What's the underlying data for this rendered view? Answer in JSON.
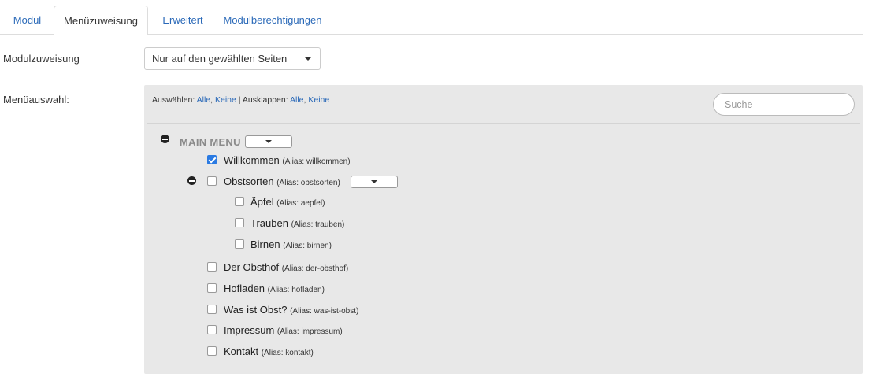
{
  "tabs": [
    {
      "label": "Modul",
      "active": false
    },
    {
      "label": "Menüzuweisung",
      "active": true
    },
    {
      "label": "Erweitert",
      "active": false
    },
    {
      "label": "Modulberechtigungen",
      "active": false
    }
  ],
  "assignment": {
    "label": "Modulzuweisung",
    "value": "Nur auf den gewählten Seiten"
  },
  "menu_selection": {
    "label": "Menüauswahl:",
    "toolbar": {
      "select_label": "Auswählen:",
      "select_all": "Alle",
      "select_sep": ",",
      "select_none": "Keine",
      "separator": "|",
      "expand_label": "Ausklappen:",
      "expand_all": "Alle",
      "expand_sep": ",",
      "expand_none": "Keine"
    },
    "search_placeholder": "Suche",
    "menu_title": "MAIN MENU",
    "items": [
      {
        "title": "Willkommen",
        "alias": "(Alias: willkommen)",
        "checked": true
      },
      {
        "title": "Obstsorten",
        "alias": "(Alias: obstsorten)",
        "checked": false
      },
      {
        "title": "Äpfel",
        "alias": "(Alias: aepfel)",
        "checked": false
      },
      {
        "title": "Trauben",
        "alias": "(Alias: trauben)",
        "checked": false
      },
      {
        "title": "Birnen",
        "alias": "(Alias: birnen)",
        "checked": false
      },
      {
        "title": "Der Obsthof",
        "alias": "(Alias: der-obsthof)",
        "checked": false
      },
      {
        "title": "Hofladen",
        "alias": "(Alias: hofladen)",
        "checked": false
      },
      {
        "title": "Was ist Obst?",
        "alias": "(Alias: was-ist-obst)",
        "checked": false
      },
      {
        "title": "Impressum",
        "alias": "(Alias: impressum)",
        "checked": false
      },
      {
        "title": "Kontakt",
        "alias": "(Alias: kontakt)",
        "checked": false
      }
    ]
  },
  "colors": {
    "link": "#2a69b8",
    "panel": "#e8e8e8",
    "check": "#2a7ae2"
  }
}
